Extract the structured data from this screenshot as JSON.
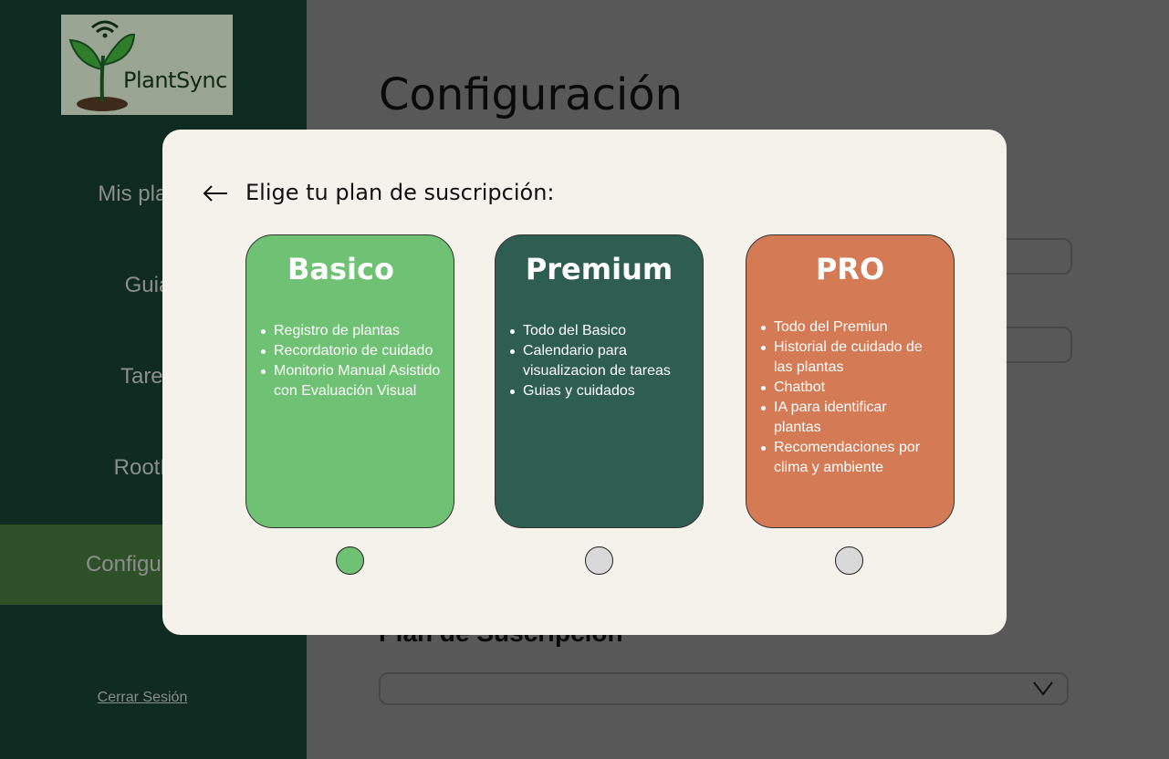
{
  "sidebar": {
    "logo_text": "PlantSync",
    "items": [
      {
        "label": "Mis plantas"
      },
      {
        "label": "Guias"
      },
      {
        "label": "Tareas"
      },
      {
        "label": "RootBot"
      },
      {
        "label": "Configuración"
      }
    ],
    "logout_label": "Cerrar Sesión"
  },
  "main": {
    "title": "Configuración",
    "plan_heading": "Plan de Suscripción",
    "plan_select_value": ""
  },
  "modal": {
    "title": "Elige tu plan de suscripción:",
    "plans": [
      {
        "name": "Basico",
        "color": "#6fc174",
        "features": [
          "Registro de plantas",
          "Recordatorio de cuidado",
          "Monitorio Manual Asistido con Evaluación Visual"
        ],
        "selected": true
      },
      {
        "name": "Premium",
        "color": "#2e5e50",
        "features": [
          "Todo del Basico",
          "Calendario para visualizacion de tareas",
          "Guias y cuidados"
        ],
        "selected": false
      },
      {
        "name": "PRO",
        "color": "#d47b55",
        "features": [
          "Todo del Premiun",
          "Historial de cuidado de las plantas",
          "Chatbot",
          "IA para identificar plantas",
          "Recomendaciones por clima y ambiente"
        ],
        "selected": false
      }
    ]
  },
  "colors": {
    "sidebar_bg": "#0f2a20",
    "active_nav_bg": "#2e5028",
    "overlay_bg": "#585858",
    "modal_bg": "#f5f2eb",
    "radio_selected": "#6fc174",
    "radio_unselected": "#d9d9d9"
  }
}
